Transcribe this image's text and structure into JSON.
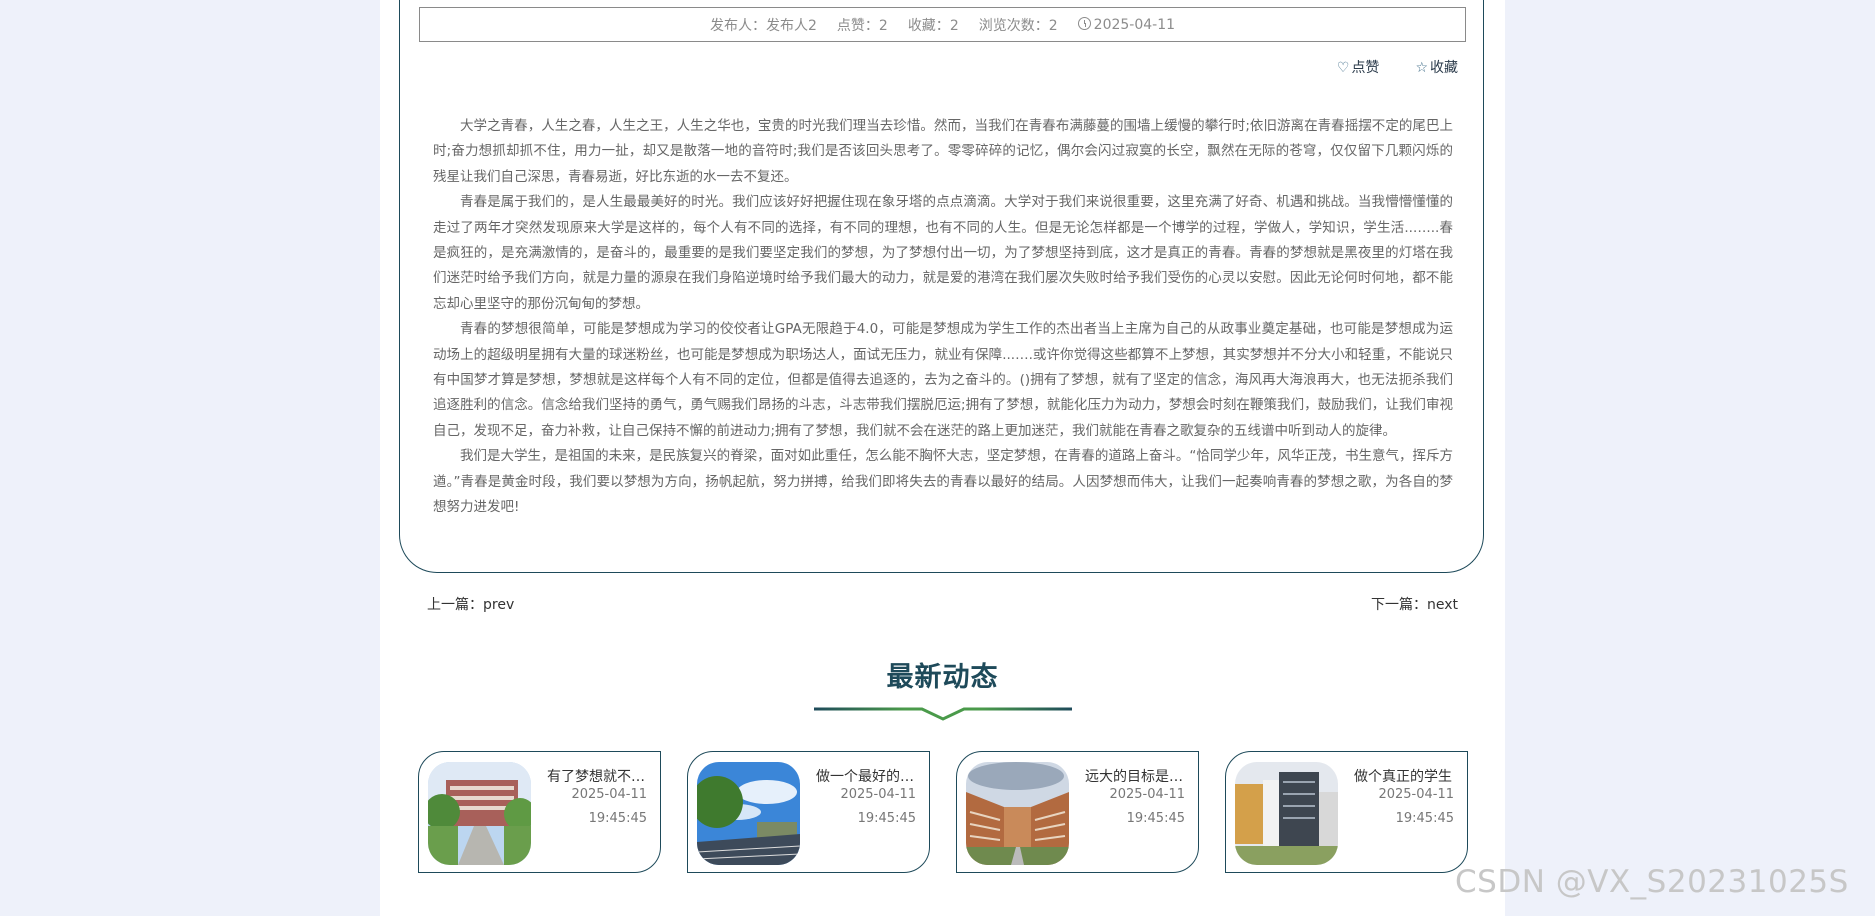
{
  "meta": {
    "publisher_label": "发布人：",
    "publisher": "发布人2",
    "likes_label": "点赞：",
    "likes": "2",
    "favorites_label": "收藏：",
    "favorites": "2",
    "views_label": "浏览次数：",
    "views": "2",
    "date": "2025-04-11"
  },
  "actions": {
    "like": "点赞",
    "favorite": "收藏"
  },
  "content": {
    "p1": "大学之青春，人生之春，人生之王，人生之华也，宝贵的时光我们理当去珍惜。然而，当我们在青春布满藤蔓的围墙上缓慢的攀行时;依旧游离在青春摇摆不定的尾巴上时;奋力想抓却抓不住，用力一扯，却又是散落一地的音符时;我们是否该回头思考了。零零碎碎的记忆，偶尔会闪过寂寞的长空，飘然在无际的苍穹，仅仅留下几颗闪烁的残星让我们自己深思，青春易逝，好比东逝的水一去不复还。",
    "p2": "青春是属于我们的，是人生最最美好的时光。我们应该好好把握住现在象牙塔的点点滴滴。大学对于我们来说很重要，这里充满了好奇、机遇和挑战。当我懵懵懂懂的走过了两年才突然发现原来大学是这样的，每个人有不同的选择，有不同的理想，也有不同的人生。但是无论怎样都是一个博学的过程，学做人，学知识，学生活..…...春是疯狂的，是充满激情的，是奋斗的，最重要的是我们要坚定我们的梦想，为了梦想付出一切，为了梦想坚持到底，这才是真正的青春。青春的梦想就是黑夜里的灯塔在我们迷茫时给予我们方向，就是力量的源泉在我们身陷逆境时给予我们最大的动力，就是爱的港湾在我们屡次失败时给予我们受伤的心灵以安慰。因此无论何时何地，都不能忘却心里坚守的那份沉甸甸的梦想。",
    "p3": "青春的梦想很简单，可能是梦想成为学习的佼佼者让GPA无限趋于4.0，可能是梦想成为学生工作的杰出者当上主席为自己的从政事业奠定基础，也可能是梦想成为运动场上的超级明星拥有大量的球迷粉丝，也可能是梦想成为职场达人，面试无压力，就业有保障...….或许你觉得这些都算不上梦想，其实梦想并不分大小和轻重，不能说只有中国梦才算是梦想，梦想就是这样每个人有不同的定位，但都是值得去追逐的，去为之奋斗的。()拥有了梦想，就有了坚定的信念，海风再大海浪再大，也无法扼杀我们追逐胜利的信念。信念给我们坚持的勇气，勇气赐我们昂扬的斗志，斗志带我们摆脱厄运;拥有了梦想，就能化压力为动力，梦想会时刻在鞭策我们，鼓励我们，让我们审视自己，发现不足，奋力补救，让自己保持不懈的前进动力;拥有了梦想，我们就不会在迷茫的路上更加迷茫，我们就能在青春之歌复杂的五线谱中听到动人的旋律。",
    "p4": "我们是大学生，是祖国的未来，是民族复兴的脊梁，面对如此重任，怎么能不胸怀大志，坚定梦想，在青春的道路上奋斗。“恰同学少年，风华正茂，书生意气，挥斥方遒。”青春是黄金时段，我们要以梦想为方向，扬帆起航，努力拼搏，给我们即将失去的青春以最好的结局。人因梦想而伟大，让我们一起奏响青春的梦想之歌，为各自的梦想努力进发吧!"
  },
  "nav": {
    "prev_label": "上一篇：",
    "prev": "prev",
    "next_label": "下一篇：",
    "next": "next"
  },
  "section": {
    "title": "最新动态",
    "accent_color": "#1e4a5a",
    "accent_green": "#4a9a4a"
  },
  "cards": [
    {
      "title": "有了梦想就不会迷茫",
      "date": "2025-04-11",
      "time": "19:45:45"
    },
    {
      "title": "做一个最好的自己",
      "date": "2025-04-11",
      "time": "19:45:45"
    },
    {
      "title": "远大的目标是梦想",
      "date": "2025-04-11",
      "time": "19:45:45"
    },
    {
      "title": "做个真正的学生",
      "date": "2025-04-11",
      "time": "19:45:45"
    }
  ],
  "watermark": "CSDN @VX_S20231025S"
}
